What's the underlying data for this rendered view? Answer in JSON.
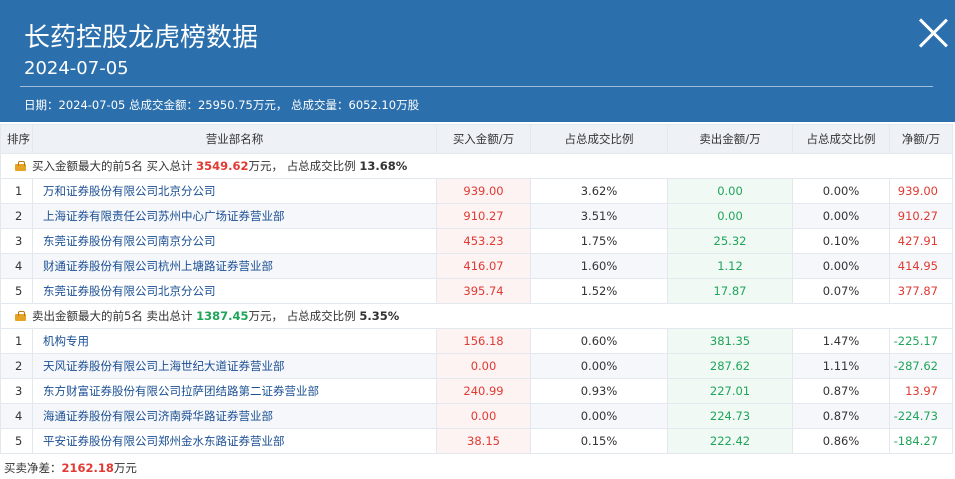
{
  "header": {
    "title": "长药控股龙虎榜数据",
    "date": "2024-07-05",
    "summary": "日期：2024-07-05 总成交金额：25950.75万元， 总成交量：6052.10万股"
  },
  "table": {
    "columns": [
      "排序",
      "营业部名称",
      "买入金额/万",
      "占总成交比例",
      "卖出金额/万",
      "占总成交比例",
      "净额/万"
    ],
    "buy_section": {
      "label": "买入金额最大的前5名",
      "total_prefix": "买入总计",
      "total": "3549.62",
      "total_suffix": "万元，",
      "ratio_prefix": "占总成交比例",
      "ratio": "13.68%",
      "rows": [
        {
          "idx": "1",
          "name": "万和证券股份有限公司北京分公司",
          "buy": "939.00",
          "buy_pct": "3.62%",
          "sell": "0.00",
          "sell_pct": "0.00%",
          "net": "939.00"
        },
        {
          "idx": "2",
          "name": "上海证券有限责任公司苏州中心广场证券营业部",
          "buy": "910.27",
          "buy_pct": "3.51%",
          "sell": "0.00",
          "sell_pct": "0.00%",
          "net": "910.27"
        },
        {
          "idx": "3",
          "name": "东莞证券股份有限公司南京分公司",
          "buy": "453.23",
          "buy_pct": "1.75%",
          "sell": "25.32",
          "sell_pct": "0.10%",
          "net": "427.91"
        },
        {
          "idx": "4",
          "name": "财通证券股份有限公司杭州上塘路证券营业部",
          "buy": "416.07",
          "buy_pct": "1.60%",
          "sell": "1.12",
          "sell_pct": "0.00%",
          "net": "414.95"
        },
        {
          "idx": "5",
          "name": "东莞证券股份有限公司北京分公司",
          "buy": "395.74",
          "buy_pct": "1.52%",
          "sell": "17.87",
          "sell_pct": "0.07%",
          "net": "377.87"
        }
      ]
    },
    "sell_section": {
      "label": "卖出金额最大的前5名",
      "total_prefix": "卖出总计",
      "total": "1387.45",
      "total_suffix": "万元，",
      "ratio_prefix": "占总成交比例",
      "ratio": "5.35%",
      "rows": [
        {
          "idx": "1",
          "name": "机构专用",
          "buy": "156.18",
          "buy_pct": "0.60%",
          "sell": "381.35",
          "sell_pct": "1.47%",
          "net": "-225.17"
        },
        {
          "idx": "2",
          "name": "天风证券股份有限公司上海世纪大道证券营业部",
          "buy": "0.00",
          "buy_pct": "0.00%",
          "sell": "287.62",
          "sell_pct": "1.11%",
          "net": "-287.62"
        },
        {
          "idx": "3",
          "name": "东方财富证券股份有限公司拉萨团结路第二证券营业部",
          "buy": "240.99",
          "buy_pct": "0.93%",
          "sell": "227.01",
          "sell_pct": "0.87%",
          "net": "13.97"
        },
        {
          "idx": "4",
          "name": "海通证券股份有限公司济南舜华路证券营业部",
          "buy": "0.00",
          "buy_pct": "0.00%",
          "sell": "224.73",
          "sell_pct": "0.87%",
          "net": "-224.73"
        },
        {
          "idx": "5",
          "name": "平安证券股份有限公司郑州金水东路证券营业部",
          "buy": "38.15",
          "buy_pct": "0.15%",
          "sell": "222.42",
          "sell_pct": "0.86%",
          "net": "-184.27"
        }
      ]
    }
  },
  "footer": {
    "label": "买卖净差：",
    "value": "2162.18",
    "unit": "万元"
  },
  "colors": {
    "header_bg": "#2b6fad",
    "positive": "#e03a32",
    "negative": "#1fa55a",
    "link": "#1a4f93"
  },
  "icons": {
    "close": "close-icon",
    "section": "briefcase-icon"
  }
}
